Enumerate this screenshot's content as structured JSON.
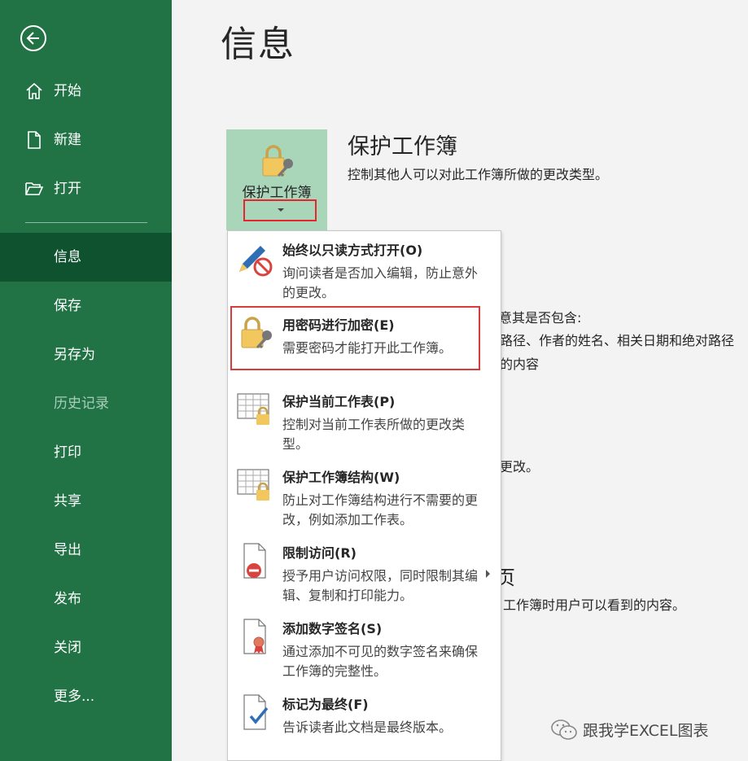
{
  "sidebar": {
    "items": [
      {
        "label": "开始",
        "icon": "home-icon"
      },
      {
        "label": "新建",
        "icon": "new-document-icon"
      },
      {
        "label": "打开",
        "icon": "open-folder-icon"
      },
      {
        "label": "信息",
        "selected": true
      },
      {
        "label": "保存"
      },
      {
        "label": "另存为"
      },
      {
        "label": "历史记录",
        "disabled": true
      },
      {
        "label": "打印"
      },
      {
        "label": "共享"
      },
      {
        "label": "导出"
      },
      {
        "label": "发布"
      },
      {
        "label": "关闭"
      },
      {
        "label": "更多..."
      }
    ]
  },
  "main": {
    "title": "信息",
    "protect": {
      "tile_label": "保护工作簿",
      "section_title": "保护工作簿",
      "section_desc": "控制其他人可以对此工作簿所做的更改类型。"
    },
    "background_fragments": {
      "line1": "注意其是否包含:",
      "line2": "路径、作者的姓名、相关日期和绝对路径",
      "line3": "的内容",
      "line4": "更改。",
      "line5": "页",
      "line6": "工作簿时用户可以看到的内容。"
    }
  },
  "menu": {
    "items": [
      {
        "title": "始终以只读方式打开(O)",
        "desc": "询问读者是否加入编辑，防止意外的更改。",
        "icon": "pencil-no-entry-icon"
      },
      {
        "title": "用密码进行加密(E)",
        "desc": "需要密码才能打开此工作簿。",
        "icon": "lock-key-icon"
      },
      {
        "title": "保护当前工作表(P)",
        "desc": "控制对当前工作表所做的更改类型。",
        "icon": "sheet-lock-icon"
      },
      {
        "title": "保护工作簿结构(W)",
        "desc": "防止对工作簿结构进行不需要的更改，例如添加工作表。",
        "icon": "workbook-lock-icon"
      },
      {
        "title": "限制访问(R)",
        "desc": "授予用户访问权限，同时限制其编辑、复制和打印能力。",
        "icon": "restrict-access-icon"
      },
      {
        "title": "添加数字签名(S)",
        "desc": "通过添加不可见的数字签名来确保工作簿的完整性。",
        "icon": "digital-signature-icon"
      },
      {
        "title": "标记为最终(F)",
        "desc": "告诉读者此文档是最终版本。",
        "icon": "mark-final-icon"
      }
    ]
  },
  "watermark": {
    "text": "跟我学EXCEL图表",
    "icon": "wechat-icon"
  },
  "colors": {
    "sidebar": "#217346",
    "sidebar_selected": "#0e5230",
    "tile": "#a9d6b9",
    "highlight": "#e8242e"
  }
}
